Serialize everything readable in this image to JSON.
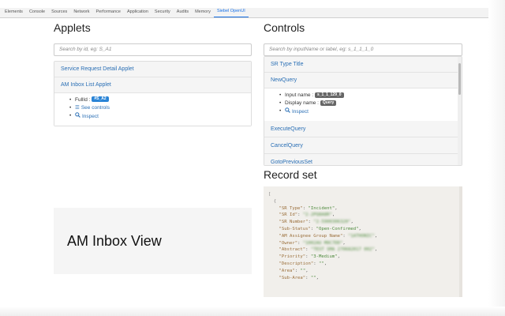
{
  "devtools_tabs": [
    {
      "label": "Elements"
    },
    {
      "label": "Console"
    },
    {
      "label": "Sources"
    },
    {
      "label": "Network"
    },
    {
      "label": "Performance"
    },
    {
      "label": "Application"
    },
    {
      "label": "Security"
    },
    {
      "label": "Audits"
    },
    {
      "label": "Memory"
    },
    {
      "label": "Siebel OpenUI",
      "active": true
    }
  ],
  "applets": {
    "title": "Applets",
    "search_placeholder": "Search by id, eg: S_A1",
    "items": [
      {
        "label": "Service Request Detail Applet"
      },
      {
        "label": "AM Inbox List Applet"
      }
    ],
    "details": {
      "fullid_label": "FullId :",
      "fullid_value": "#S_A2",
      "see_controls": "See controls",
      "inspect": "Inspect"
    }
  },
  "view": {
    "title": "AM Inbox View"
  },
  "controls": {
    "title": "Controls",
    "search_placeholder": "Search by inputName or label, eg: s_1_1_1_0",
    "items": [
      {
        "label": "SR Type Title"
      },
      {
        "label": "NewQuery"
      },
      {
        "label": "ExecuteQuery"
      },
      {
        "label": "CancelQuery"
      },
      {
        "label": "GotoPreviousSet"
      }
    ],
    "details": {
      "input_name_label": "Input name :",
      "input_name_value": "s_1_1_129_0",
      "display_name_label": "Display name :",
      "display_name_value": "Query",
      "inspect": "Inspect"
    }
  },
  "record_set": {
    "title": "Record set",
    "lines": [
      {
        "k": "\"SR Type\"",
        "v": "\"Incident\""
      },
      {
        "k": "\"SR Id\"",
        "v": "\"2-2PQ8A8R\""
      },
      {
        "k": "\"SR Number\"",
        "v": "\"2-5900306320\""
      },
      {
        "k": "\"Sub-Status\"",
        "v": "\"Open-Confirmed\""
      },
      {
        "k": "\"AM Assignee Group Name\"",
        "v": "\"1ATHONIC\""
      },
      {
        "k": "\"Owner\"",
        "v": "\"1002AU M0C7DD\""
      },
      {
        "k": "\"Abstract\"",
        "v": "\"TEST SMA 270682017 002\""
      },
      {
        "k": "\"Priority\"",
        "v": "\"3-Medium\""
      },
      {
        "k": "\"Description\"",
        "v": "\"\""
      },
      {
        "k": "\"Area\"",
        "v": "\"\""
      },
      {
        "k": "\"Sub-Area\"",
        "v": "\"\""
      }
    ],
    "blurred_indices": [
      1,
      2,
      4,
      5,
      6
    ]
  },
  "colors": {
    "link": "#2a6fb5",
    "badge_blue": "#2a84d6",
    "badge_gray": "#666666",
    "code_bg": "#f1efeb"
  }
}
